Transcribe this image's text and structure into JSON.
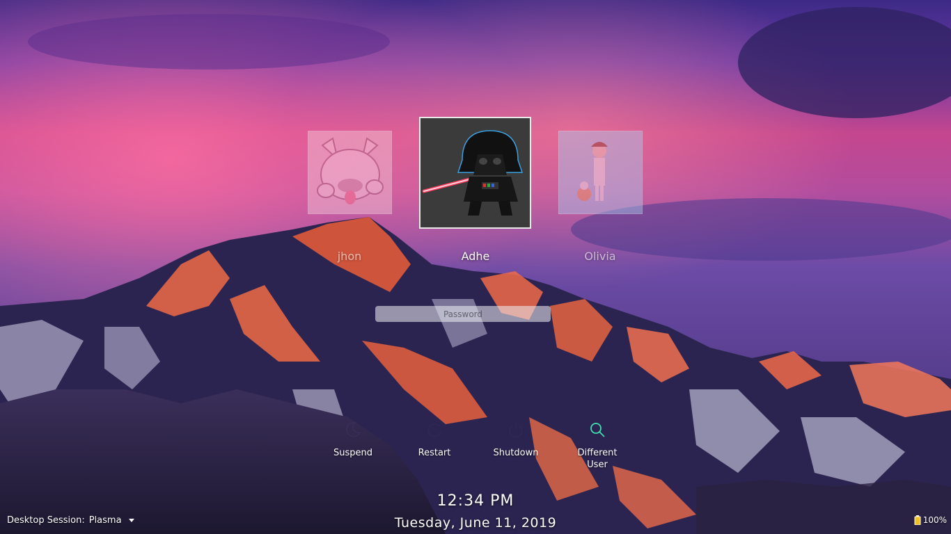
{
  "users": [
    {
      "name": "jhon",
      "selected": false,
      "avatar": "bulldog-avatar"
    },
    {
      "name": "Adhe",
      "selected": true,
      "avatar": "darth-vader-avatar"
    },
    {
      "name": "Olivia",
      "selected": false,
      "avatar": "girl-avatar"
    }
  ],
  "password": {
    "placeholder": "Password",
    "value": ""
  },
  "actions": {
    "suspend": {
      "label": "Suspend",
      "icon": "moon-icon"
    },
    "restart": {
      "label": "Restart",
      "icon": "restart-icon"
    },
    "shutdown": {
      "label": "Shutdown",
      "icon": "power-icon"
    },
    "different_user": {
      "label": "Different User",
      "icon": "search-icon",
      "accent": "#3fe0b0"
    }
  },
  "clock": {
    "time": "12:34 PM",
    "date": "Tuesday, June 11, 2019"
  },
  "session": {
    "label": "Desktop Session:",
    "value": "Plasma"
  },
  "battery": {
    "level": "100%",
    "icon": "battery-icon"
  }
}
